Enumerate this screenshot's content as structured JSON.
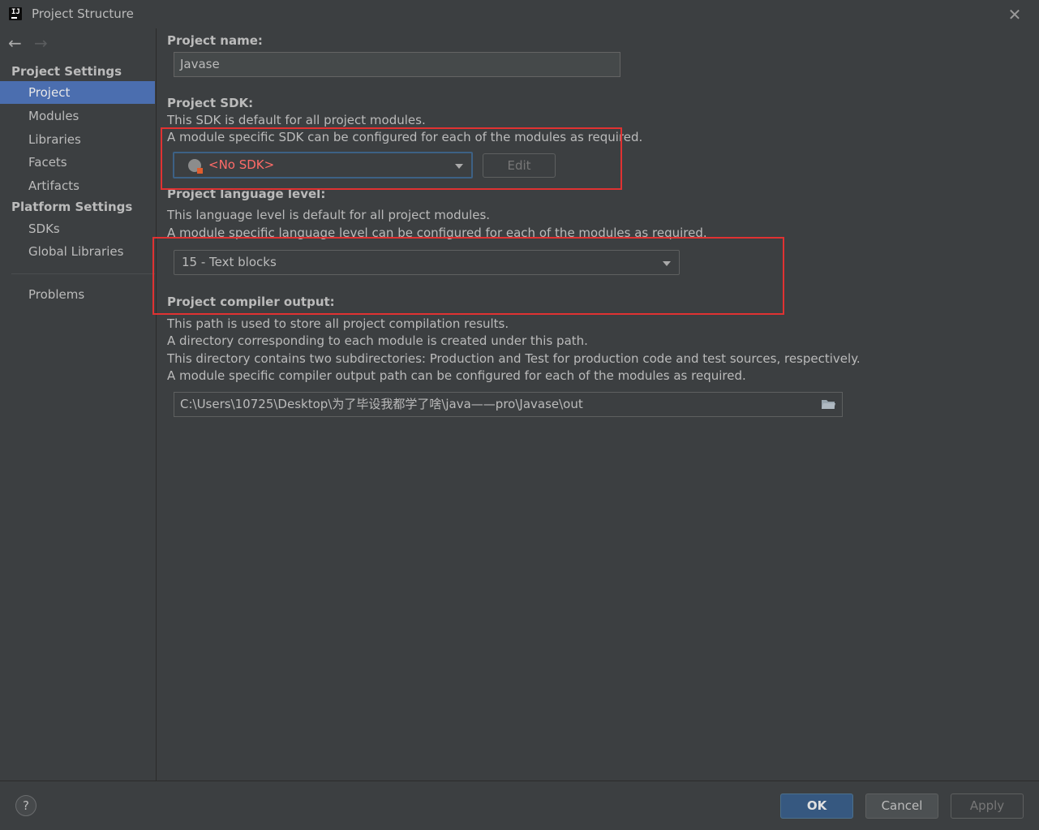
{
  "window": {
    "title": "Project Structure",
    "app_icon": "intellij-idea-icon",
    "close_icon": "close-icon"
  },
  "nav": {
    "back_icon": "arrow-left-icon",
    "forward_icon": "arrow-right-icon"
  },
  "sidebar": {
    "project_settings_title": "Project Settings",
    "project_items": [
      "Project",
      "Modules",
      "Libraries",
      "Facets",
      "Artifacts"
    ],
    "platform_settings_title": "Platform Settings",
    "platform_items": [
      "SDKs",
      "Global Libraries"
    ],
    "problems": "Problems",
    "selected": "Project"
  },
  "main": {
    "name_label": "Project name:",
    "name_value": "Javase",
    "sdk_label": "Project SDK:",
    "sdk_desc1": "This SDK is default for all project modules.",
    "sdk_desc2": "A module specific SDK can be configured for each of the modules as required.",
    "sdk_value": "<No SDK>",
    "sdk_value_color": "#ff6b68",
    "edit_button": "Edit",
    "lang_label": "Project language level:",
    "lang_desc1": "This language level is default for all project modules.",
    "lang_desc2": "A module specific language level can be configured for each of the modules as required.",
    "lang_value": "15 - Text blocks",
    "compiler_label": "Project compiler output:",
    "compiler_desc1": "This path is used to store all project compilation results.",
    "compiler_desc2": "A directory corresponding to each module is created under this path.",
    "compiler_desc3": "This directory contains two subdirectories: Production and Test for production code and test sources, respectively.",
    "compiler_desc4": "A module specific compiler output path can be configured for each of the modules as required.",
    "compiler_path": "C:\\Users\\10725\\Desktop\\为了毕设我都学了啥\\java——pro\\Javase\\out",
    "folder_icon": "folder-icon"
  },
  "footer": {
    "help": "?",
    "ok": "OK",
    "cancel": "Cancel",
    "apply": "Apply"
  },
  "colors": {
    "accent": "#4b6eaf",
    "highlight_box": "#e03232"
  }
}
